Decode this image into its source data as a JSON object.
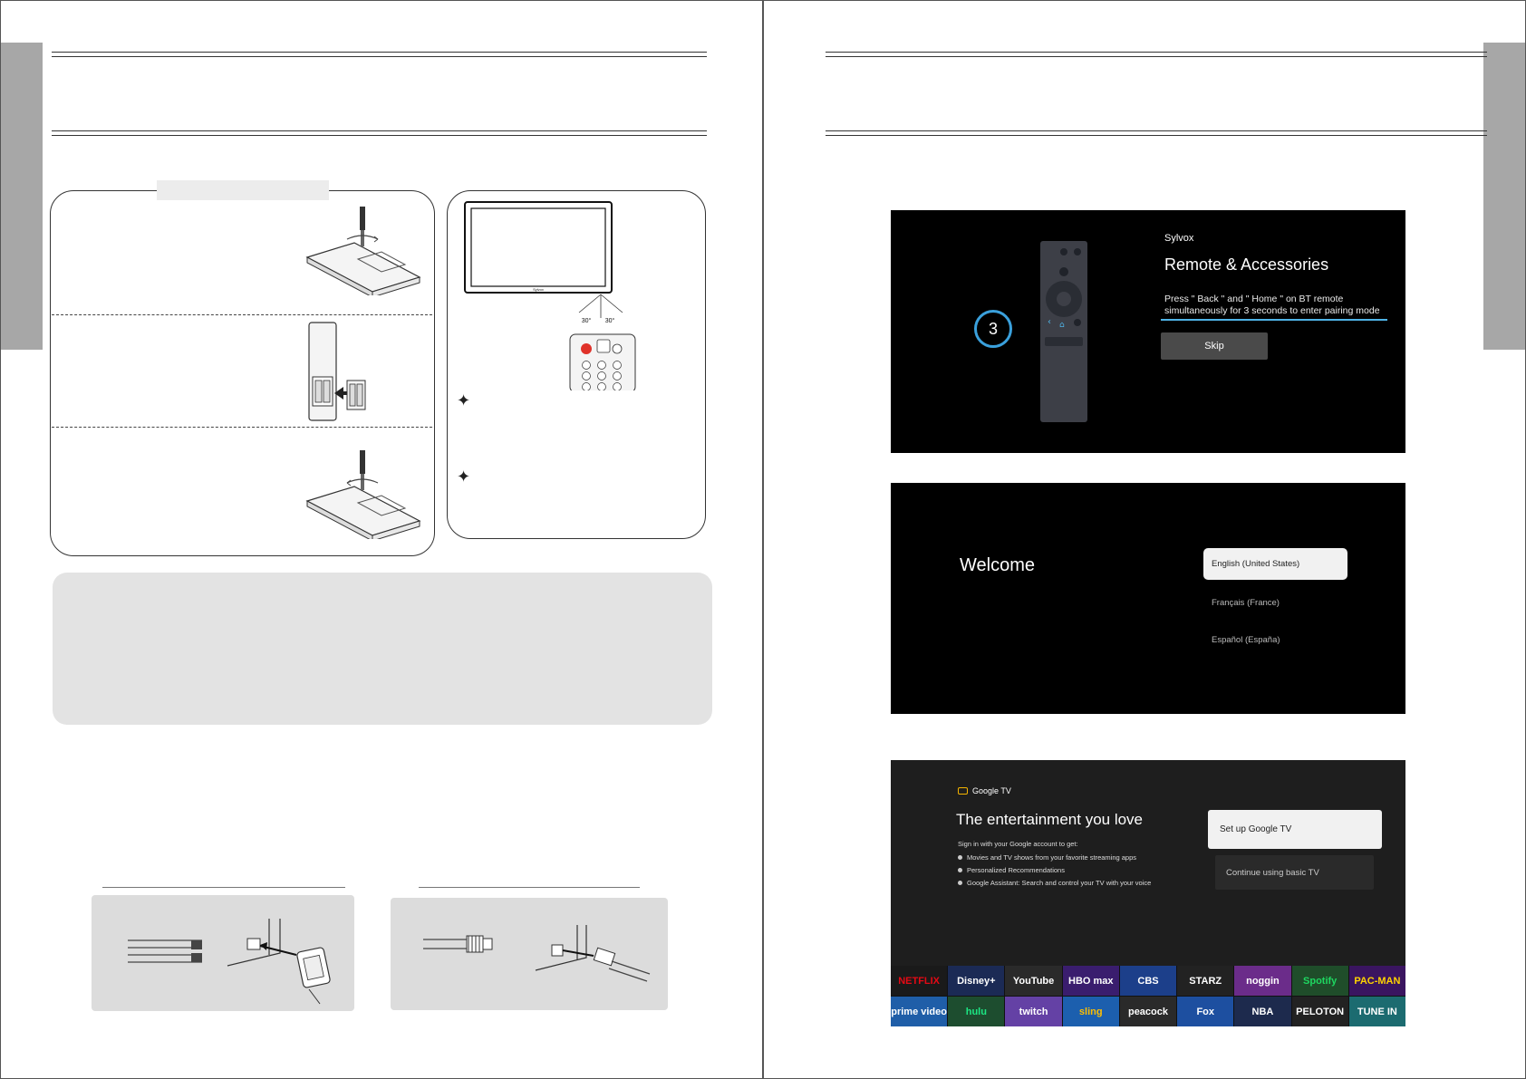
{
  "screens": {
    "pairing": {
      "brand": "Sylvox",
      "title": "Remote & Accessories",
      "description": "Press \" Back \" and \" Home \" on BT remote simultaneously for 3 seconds to enter pairing mode",
      "countdown": "3",
      "skip_label": "Skip",
      "progress_fraction": 1.0
    },
    "welcome": {
      "title": "Welcome",
      "languages": [
        "English (United States)",
        "Français (France)",
        "Español (España)"
      ],
      "selected_index": 0
    },
    "google_tv": {
      "brand": "Google TV",
      "title": "The entertainment you love",
      "subtitle": "Sign in with your Google account to get:",
      "benefits": [
        "Movies and TV shows from your favorite streaming apps",
        "Personalized Recommendations",
        "Google Assistant: Search and control your TV with your voice"
      ],
      "setup_label": "Set up Google TV",
      "basic_label": "Continue using basic TV",
      "apps": [
        {
          "name": "NETFLIX",
          "bg": "#1a1a1a",
          "fg": "#e50914"
        },
        {
          "name": "Disney+",
          "bg": "#1b2a55",
          "fg": "#ffffff"
        },
        {
          "name": "YouTube",
          "bg": "#2a2a2a",
          "fg": "#ffffff"
        },
        {
          "name": "HBO max",
          "bg": "#3a1d6e",
          "fg": "#ffffff"
        },
        {
          "name": "CBS",
          "bg": "#1c3f8a",
          "fg": "#ffffff"
        },
        {
          "name": "STARZ",
          "bg": "#222222",
          "fg": "#ffffff"
        },
        {
          "name": "noggin",
          "bg": "#6b2c8a",
          "fg": "#ffffff"
        },
        {
          "name": "Spotify",
          "bg": "#1f4d2a",
          "fg": "#1ed760"
        },
        {
          "name": "PAC-MAN",
          "bg": "#3a1560",
          "fg": "#ffd400"
        },
        {
          "name": "prime video",
          "bg": "#1f5ea8",
          "fg": "#ffffff"
        },
        {
          "name": "hulu",
          "bg": "#1d4d2f",
          "fg": "#1ce783"
        },
        {
          "name": "twitch",
          "bg": "#6441a5",
          "fg": "#ffffff"
        },
        {
          "name": "sling",
          "bg": "#1c5fae",
          "fg": "#ffbf00"
        },
        {
          "name": "peacock",
          "bg": "#2a2a2a",
          "fg": "#ffffff"
        },
        {
          "name": "Fox",
          "bg": "#1d4fa0",
          "fg": "#ffffff"
        },
        {
          "name": "NBA",
          "bg": "#1d2a4d",
          "fg": "#ffffff"
        },
        {
          "name": "PELOTON",
          "bg": "#222222",
          "fg": "#ffffff"
        },
        {
          "name": "TUNE IN",
          "bg": "#1c6b70",
          "fg": "#ffffff"
        }
      ]
    }
  },
  "remote_panel": {
    "angle_left": "30°",
    "angle_right": "30°",
    "tv_brand": "Sylvox",
    "star_glyph": "✦"
  }
}
